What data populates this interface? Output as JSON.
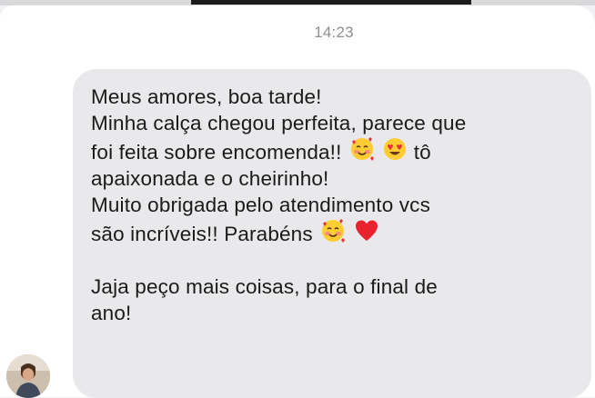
{
  "status_time": "14:23",
  "message": {
    "lines": [
      "Meus amores, boa tarde!",
      "Minha calça chegou perfeita, parece que",
      "foi feita sobre encomenda!!",
      "tô",
      "apaixonada e o cheirinho!",
      "Muito obrigada pelo atendimento vcs",
      "são incríveis!! Parabéns",
      "Jaja peço mais coisas, para o final de",
      "ano!"
    ],
    "icons": [
      "smiling-face-with-hearts",
      "heart-eyes",
      "smiling-face-with-hearts",
      "red-heart"
    ]
  },
  "colors": {
    "bubble": "#e9e9eb",
    "text": "#1a1a1a",
    "timestamp": "#8e8e93",
    "background": "#ffffff"
  }
}
